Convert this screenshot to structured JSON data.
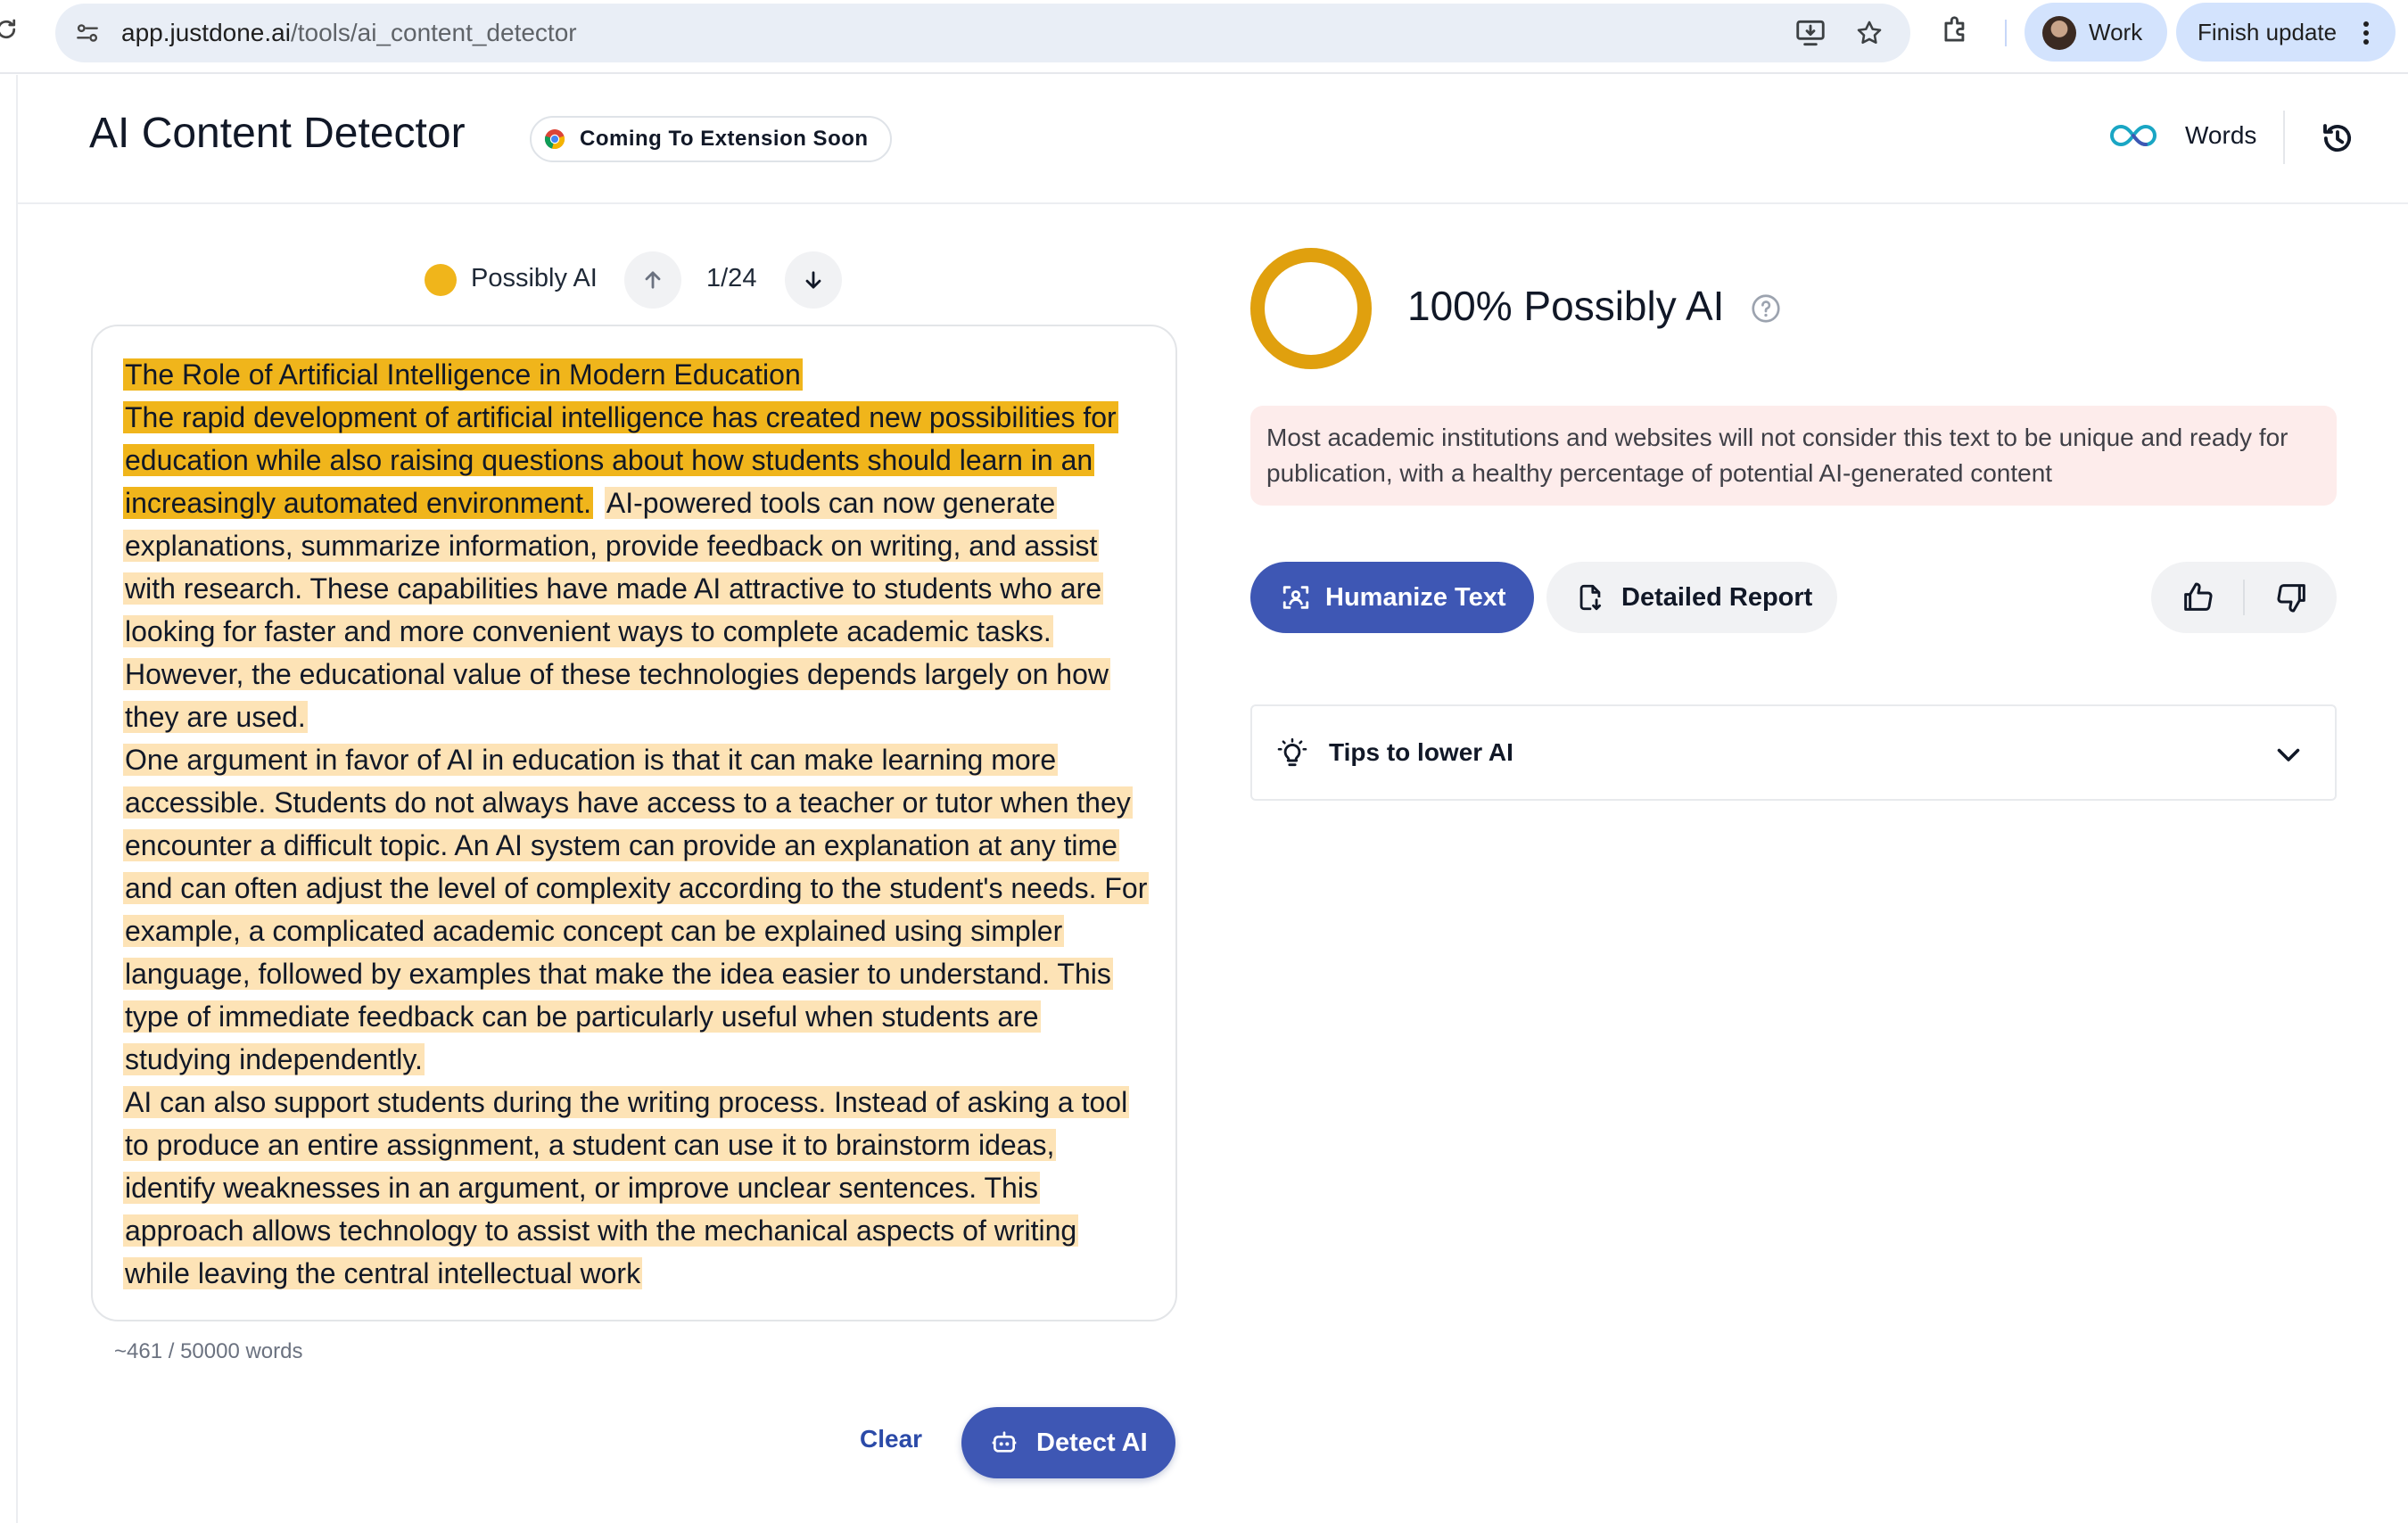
{
  "browser": {
    "url_host": "app.justdone.ai",
    "url_path": "/tools/ai_content_detector",
    "profile_name": "Work",
    "update_button": "Finish update"
  },
  "header": {
    "title": "AI Content Detector",
    "extension_badge": "Coming To Extension Soon",
    "words_label": "Words"
  },
  "navigator": {
    "status_label": "Possibly AI",
    "counter": "1/24"
  },
  "editor": {
    "segments": [
      {
        "text": "The Role of Artificial Intelligence in Modern Education\nThe rapid development of artificial intelligence has created new possibilities for education while also raising questions about how students should learn in an increasingly automated environment.",
        "level": "strong"
      },
      {
        "text": " ",
        "level": "none"
      },
      {
        "text": "AI-powered tools can now generate explanations, summarize information, provide feedback on writing, and assist with research. These capabilities have made AI attractive to students who are looking for faster and more convenient ways to complete academic tasks. However, the educational value of these technologies depends largely on how they are used.\nOne argument in favor of AI in education is that it can make learning more accessible. Students do not always have access to a teacher or tutor when they encounter a difficult topic. An AI system can provide an explanation at any time and can often adjust the level of complexity according to the student's needs. For example, a complicated academic concept can be explained using simpler language, followed by examples that make the idea easier to understand. This type of immediate feedback can be particularly useful when students are studying independently.\nAI can also support students during the writing process. Instead of asking a tool to produce an entire assignment, a student can use it to brainstorm ideas, identify weaknesses in an argument, or improve unclear sentences. This approach allows technology to assist with the mechanical aspects of writing while leaving the central intellectual work",
        "level": "light"
      }
    ],
    "word_count": "~461 / 50000 words"
  },
  "actions": {
    "clear": "Clear",
    "detect": "Detect AI"
  },
  "result": {
    "score_text": "100% Possibly AI",
    "score_fraction": 1.0,
    "notice": "Most academic institutions and websites will not consider this text to be unique and ready for publication, with a healthy percentage of potential AI-generated content",
    "humanize_button": "Humanize Text",
    "report_button": "Detailed Report",
    "tips_label": "Tips to lower AI"
  },
  "colors": {
    "accent": "#3e57b4",
    "ai_strong": "#f0b51b",
    "ai_light": "#fde3b6",
    "ring": "#e0a00e",
    "notice_bg": "#fdeceb"
  }
}
